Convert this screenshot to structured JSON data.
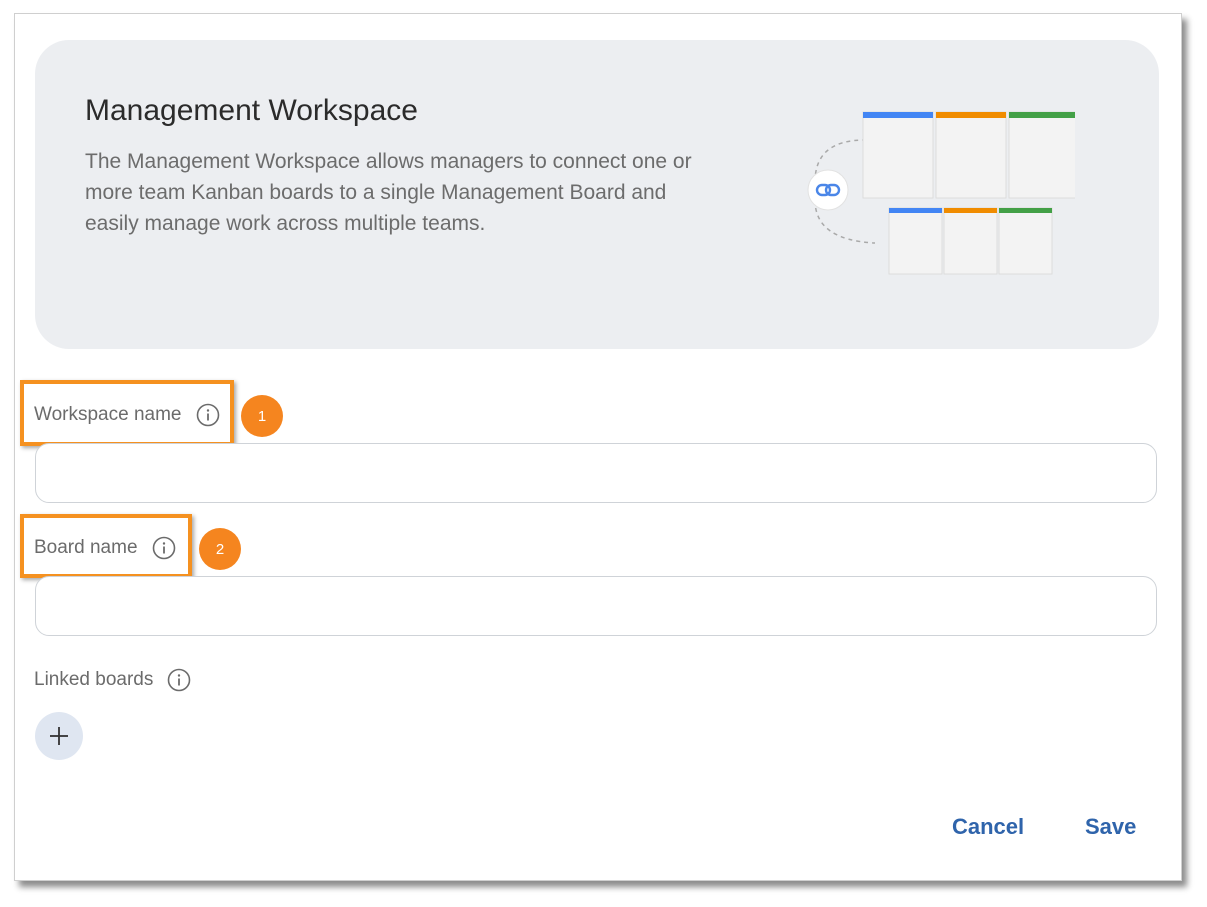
{
  "banner": {
    "title": "Management Workspace",
    "description": "The Management Workspace allows managers to connect one or more team Kanban boards to a single Management Board and easily manage work across multiple teams."
  },
  "fields": {
    "workspace_name": {
      "label": "Workspace name",
      "value": "",
      "step": "1"
    },
    "board_name": {
      "label": "Board name",
      "value": "",
      "step": "2"
    },
    "linked_boards": {
      "label": "Linked boards"
    }
  },
  "actions": {
    "cancel": "Cancel",
    "save": "Save"
  },
  "colors": {
    "accent": "#2f64ab",
    "callout": "#f59120",
    "lane_blue": "#4285f4",
    "lane_orange": "#f08c00",
    "lane_green": "#43a047"
  },
  "icons": {
    "info": "info-icon",
    "link": "link-icon",
    "add": "plus-icon"
  }
}
